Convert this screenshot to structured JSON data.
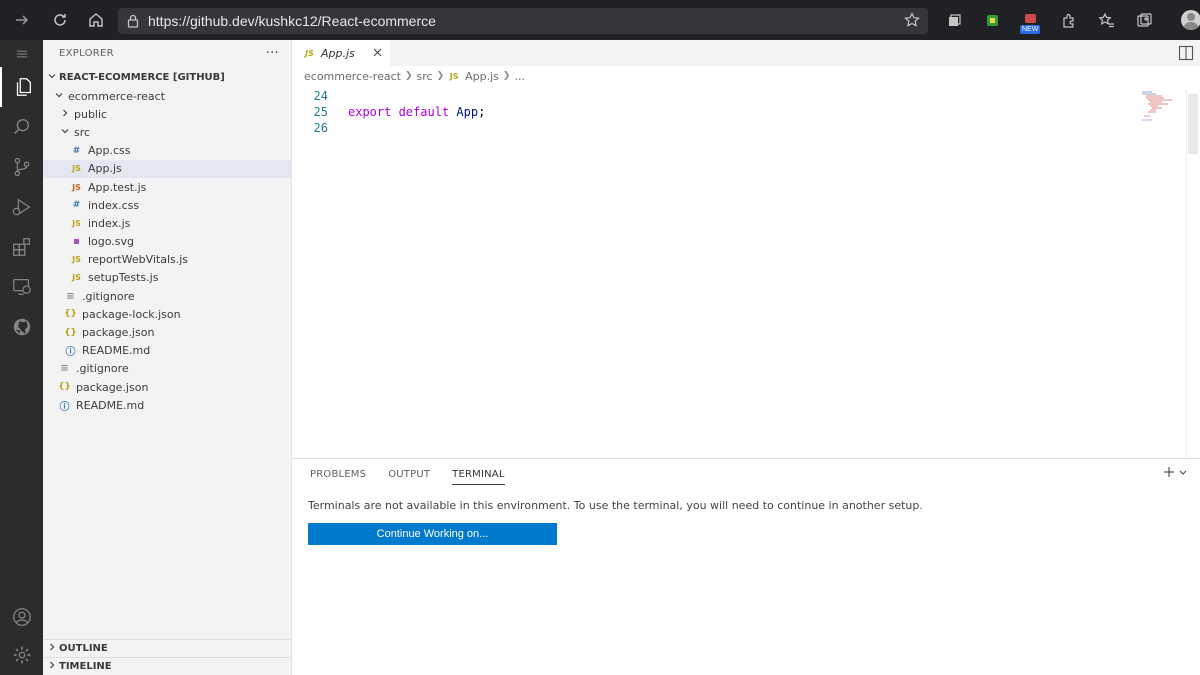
{
  "browser": {
    "url": "https://github.dev/kushkc12/React-ecommerce",
    "new_badge": "NEW"
  },
  "explorer": {
    "header": "EXPLORER",
    "more": "···",
    "repo": "REACT-ECOMMERCE [GITHUB]",
    "tree": [
      {
        "label": "ecommerce-react",
        "type": "folder-open",
        "depth": 1
      },
      {
        "label": "public",
        "type": "folder-closed",
        "depth": 2
      },
      {
        "label": "src",
        "type": "folder-open",
        "depth": 2
      },
      {
        "label": "App.css",
        "type": "css",
        "depth": 3
      },
      {
        "label": "App.js",
        "type": "js",
        "depth": 3,
        "selected": true
      },
      {
        "label": "App.test.js",
        "type": "jsred",
        "depth": 3
      },
      {
        "label": "index.css",
        "type": "css",
        "depth": 3
      },
      {
        "label": "index.js",
        "type": "js",
        "depth": 3
      },
      {
        "label": "logo.svg",
        "type": "svg",
        "depth": 3
      },
      {
        "label": "reportWebVitals.js",
        "type": "js",
        "depth": 3
      },
      {
        "label": "setupTests.js",
        "type": "js",
        "depth": 3
      },
      {
        "label": ".gitignore",
        "type": "git",
        "depth": 2
      },
      {
        "label": "package-lock.json",
        "type": "json",
        "depth": 2
      },
      {
        "label": "package.json",
        "type": "json",
        "depth": 2
      },
      {
        "label": "README.md",
        "type": "info",
        "depth": 2
      },
      {
        "label": ".gitignore",
        "type": "git",
        "depth": 1
      },
      {
        "label": "package.json",
        "type": "json",
        "depth": 1
      },
      {
        "label": "README.md",
        "type": "info",
        "depth": 1
      }
    ],
    "outline": "OUTLINE",
    "timeline": "TIMELINE"
  },
  "editor": {
    "tab_label": "App.js",
    "tab_icon": "JS",
    "breadcrumb": [
      "ecommerce-react",
      "src",
      "App.js",
      "..."
    ],
    "lines": [
      {
        "number": "24",
        "keyword": "",
        "ident": "",
        "punc": ""
      },
      {
        "number": "25",
        "keyword": "export default",
        "ident": "App",
        "punc": ";"
      },
      {
        "number": "26",
        "keyword": "",
        "ident": "",
        "punc": ""
      }
    ]
  },
  "panel": {
    "tabs": [
      "PROBLEMS",
      "OUTPUT",
      "TERMINAL"
    ],
    "active_tab": "TERMINAL",
    "message": "Terminals are not available in this environment. To use the terminal, you will need to continue in another setup.",
    "button_label": "Continue Working on..."
  },
  "icons": {
    "activity": [
      "explorer-icon",
      "search-icon",
      "source-control-icon",
      "run-debug-icon",
      "extensions-icon",
      "remote-explorer-icon",
      "github-icon",
      "accounts-icon",
      "manage-gear-icon"
    ]
  },
  "colors": {
    "accent": "#007acc",
    "activity_bar": "#2c2c2c",
    "sidebar": "#f3f3f3",
    "keyword": "#af00db",
    "identifier": "#001080",
    "line_number": "#237893"
  }
}
